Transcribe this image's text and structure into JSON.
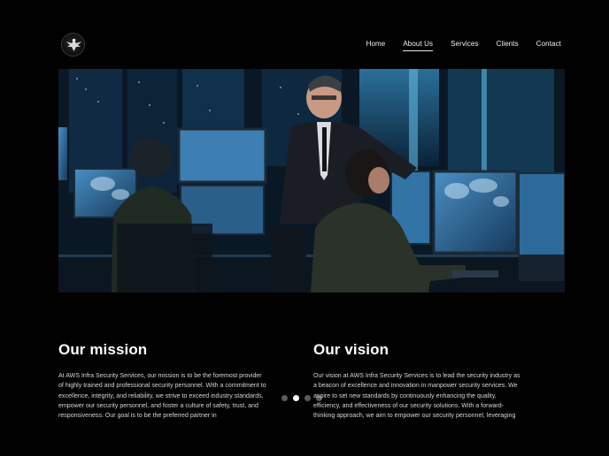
{
  "header": {
    "logo_icon": "eagle-emblem-icon",
    "nav": [
      {
        "label": "Home",
        "active": false
      },
      {
        "label": "About Us",
        "active": true
      },
      {
        "label": "Services",
        "active": false
      },
      {
        "label": "Clients",
        "active": false
      },
      {
        "label": "Contact",
        "active": false
      }
    ]
  },
  "hero": {
    "image_subject": "security-operations-control-room-photo"
  },
  "mission": {
    "title": "Our mission",
    "body": "At AWS Infra Security Services, our mission is to be the foremost provider of highly trained and professional security personnel. With a commitment to excellence, integrity, and reliability, we strive to exceed industry standards, empower our security personnel, and foster a culture of safety, trust, and responsiveness. Our goal is to be the preferred partner in"
  },
  "vision": {
    "title": "Our vision",
    "body": "Our vision at AWS Infra Security Services is to lead the security industry as a beacon of excellence and innovation in manpower security services. We aspire to set new standards by continuously enhancing the quality, efficiency, and effectiveness of our security solutions. With a forward-thinking approach, we aim to empower our security personnel, leveraging"
  },
  "carousel": {
    "slide_count": 4,
    "active_index": 1
  },
  "colors": {
    "background": "#010101",
    "text": "#ffffff",
    "body_text": "#d6d6d6",
    "dot_inactive": "#5b5b5b",
    "dot_active": "#ffffff"
  }
}
